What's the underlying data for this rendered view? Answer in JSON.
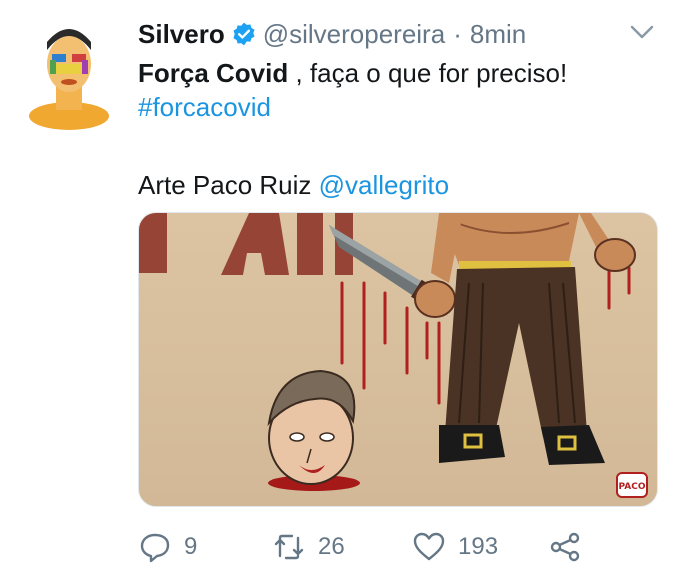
{
  "tweet": {
    "display_name": "Silvero",
    "handle": "@silveropereira",
    "separator": "·",
    "timestamp": "8min",
    "line1_bold": "Força Covid",
    "line1_rest": " , faça o que for preciso!",
    "hashtag": "#forcacovid",
    "credit_text": "Arte Paco Ruiz ",
    "credit_mention": "@vallegrito",
    "media_signature": "PACO"
  },
  "actions": {
    "reply_count": "9",
    "retweet_count": "26",
    "like_count": "193"
  },
  "icons": {
    "verified": "verified-badge-icon",
    "caret": "chevron-down-icon",
    "reply": "reply-icon",
    "retweet": "retweet-icon",
    "like": "heart-icon",
    "share": "share-icon"
  },
  "colors": {
    "link": "#1b95e0",
    "verified": "#1da1f2",
    "muted": "#657786",
    "text": "#14171a"
  }
}
